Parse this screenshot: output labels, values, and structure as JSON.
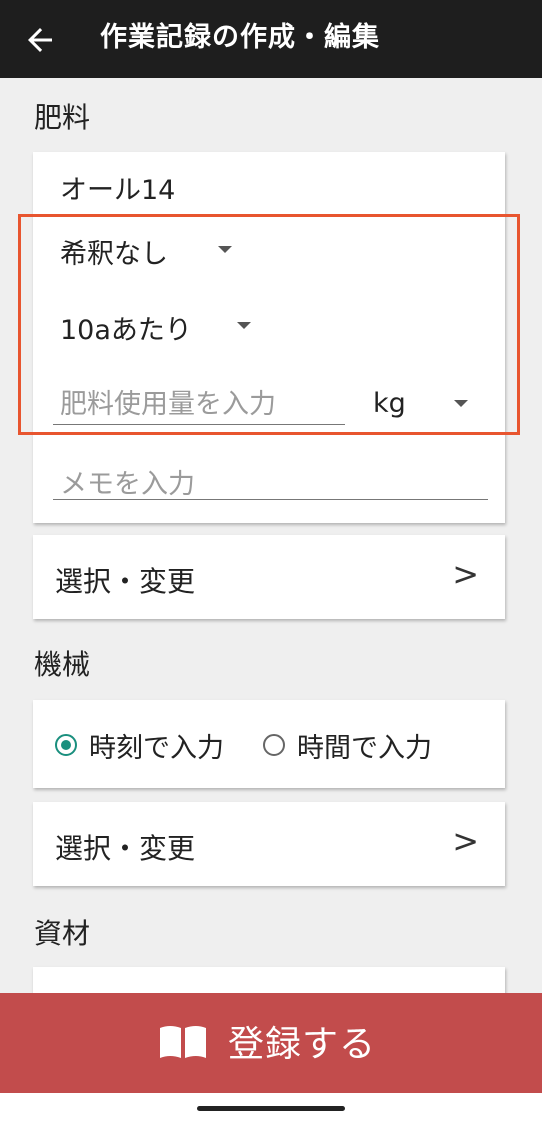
{
  "appbar": {
    "title": "作業記録の作成・編集",
    "back_icon": "arrow-left-icon"
  },
  "fertilizer": {
    "section_label": "肥料",
    "name": "オール14",
    "dilution": "希釈なし",
    "per_area": "10aあたり",
    "amount_placeholder": "肥料使用量を入力",
    "amount_value": "",
    "unit": "kg",
    "memo_placeholder": "メモを入力",
    "memo_value": "",
    "select_label": "選択・変更",
    "chevron": ">"
  },
  "machine": {
    "section_label": "機械",
    "options": [
      "時刻で入力",
      "時間で入力"
    ],
    "selected": "時刻で入力",
    "select_label": "選択・変更",
    "chevron": ">"
  },
  "material": {
    "section_label": "資材"
  },
  "submit": {
    "label": "登録する",
    "icon": "book-icon",
    "color": "#c24c4c"
  },
  "colors": {
    "highlight": "#e8552f",
    "radio_accent": "#1a8f7e"
  }
}
